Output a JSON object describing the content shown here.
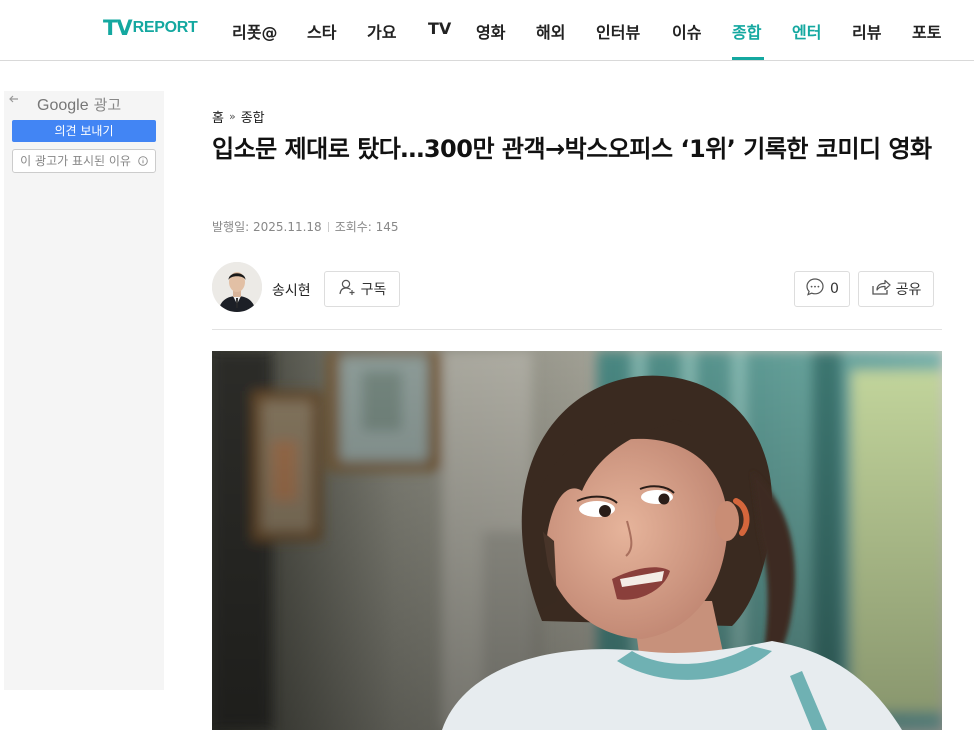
{
  "header": {
    "logo_tv": "TV",
    "logo_report": "REPORT",
    "nav": [
      {
        "label": "리폿@"
      },
      {
        "label": "스타"
      },
      {
        "label": "가요"
      },
      {
        "label": "TV"
      },
      {
        "label": "영화"
      },
      {
        "label": "해외"
      },
      {
        "label": "인터뷰"
      },
      {
        "label": "이슈"
      },
      {
        "label": "종합"
      },
      {
        "label": "엔터"
      },
      {
        "label": "리뷰"
      },
      {
        "label": "포토"
      }
    ],
    "active_nav": "종합",
    "accent_color": "#14a8a0"
  },
  "ad": {
    "back_icon": "arrow-left-icon",
    "brand": "Google",
    "brand_sub": "광고",
    "feedback_label": "의견 보내기",
    "why_label": "이 광고가 표시된 이유",
    "info_icon": "info-icon",
    "feedback_color": "#4285f4"
  },
  "article": {
    "breadcrumb": {
      "home": "홈",
      "separator": "»",
      "section": "종합"
    },
    "title": "입소문 제대로 탔다…300만 관객→박스오피스 ‘1위’ 기록한 코미디 영화",
    "meta": {
      "published": "발행일: 2025.11.18",
      "views": "조회수: 145"
    },
    "author": {
      "name": "송시현",
      "subscribe_label": "구독",
      "comment_count": "0",
      "share_label": "공유"
    }
  }
}
